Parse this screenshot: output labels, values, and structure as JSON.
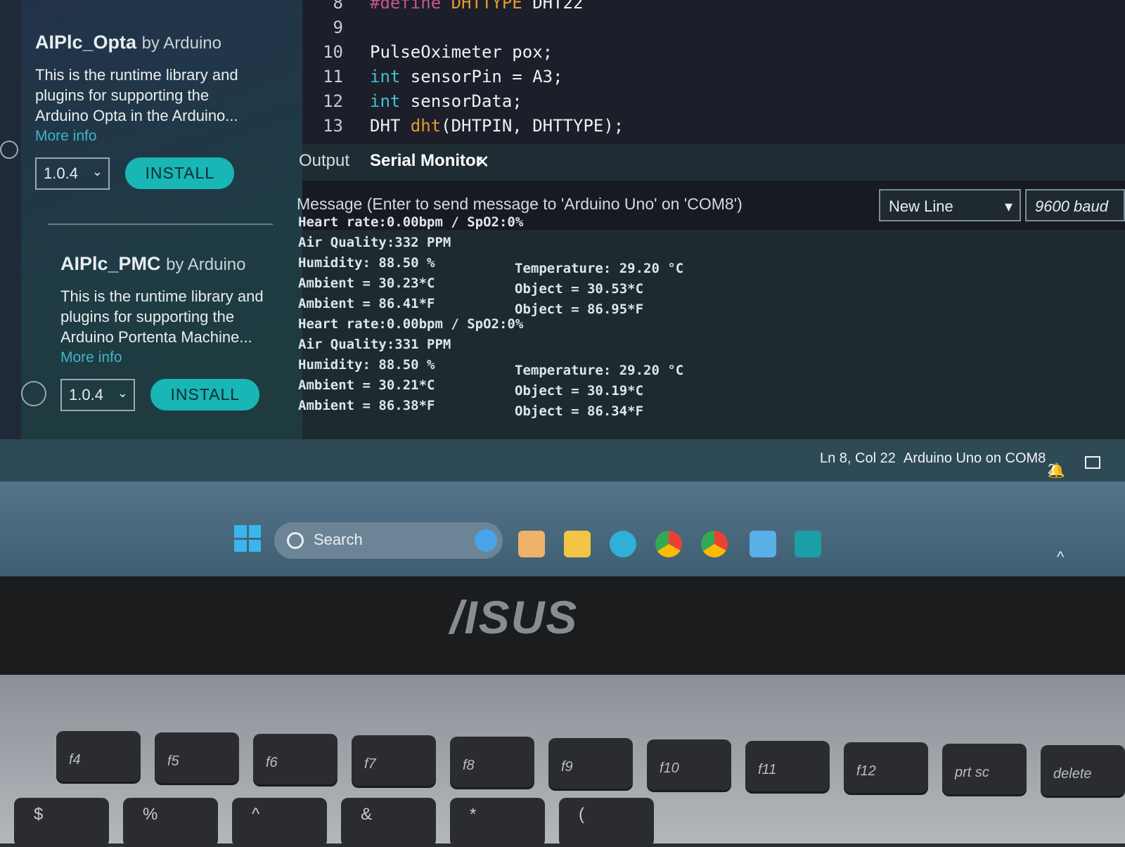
{
  "libraries": [
    {
      "name": "AIPlc_Opta",
      "by": "by Arduino",
      "description": [
        "This is the runtime library and",
        "plugins for supporting the",
        "Arduino Opta in the Arduino..."
      ],
      "more": "More info",
      "version": "1.0.4",
      "install_label": "INSTALL"
    },
    {
      "name": "AIPlc_PMC",
      "by": "by Arduino",
      "description": [
        "This is the runtime library and",
        "plugins for supporting the",
        "Arduino Portenta Machine..."
      ],
      "more": "More info",
      "version": "1.0.4",
      "install_label": "INSTALL"
    }
  ],
  "editor": {
    "lines": [
      {
        "n": "8",
        "parts": [
          [
            "def",
            "#define "
          ],
          [
            "fn",
            "DHTTYPE"
          ],
          [
            "",
            " DHT22"
          ]
        ]
      },
      {
        "n": "9",
        "parts": [
          [
            "",
            ""
          ]
        ]
      },
      {
        "n": "10",
        "parts": [
          [
            "",
            "PulseOximeter pox;"
          ]
        ]
      },
      {
        "n": "11",
        "parts": [
          [
            "kw",
            "int"
          ],
          [
            "",
            " sensorPin = A3;"
          ]
        ]
      },
      {
        "n": "12",
        "parts": [
          [
            "kw",
            "int"
          ],
          [
            "",
            " sensorData;"
          ]
        ]
      },
      {
        "n": "13",
        "parts": [
          [
            "",
            "DHT "
          ],
          [
            "fn",
            "dht"
          ],
          [
            "",
            "(DHTPIN, DHTTYPE);"
          ]
        ]
      }
    ]
  },
  "panel": {
    "tab_output": "Output",
    "tab_serial": "Serial Monitor",
    "close_glyph": "✕",
    "message_placeholder": "Message (Enter to send message to 'Arduino Uno' on 'COM8')",
    "line_ending": "New Line",
    "baud": "9600 baud",
    "collapse_glyph": "»"
  },
  "serial_lines": [
    [
      "Heart rate:0.00bpm / SpO2:0%",
      ""
    ],
    [
      "Air Quality:332 PPM",
      ""
    ],
    [
      "Humidity: 88.50 %",
      "Temperature: 29.20 °C"
    ],
    [
      "Ambient = 30.23*C",
      "Object = 30.53*C"
    ],
    [
      "Ambient = 86.41*F",
      "Object = 86.95*F"
    ],
    [
      "Heart rate:0.00bpm / SpO2:0%",
      ""
    ],
    [
      "Air Quality:331 PPM",
      ""
    ],
    [
      "Humidity: 88.50 %",
      "Temperature: 29.20 °C"
    ],
    [
      "Ambient = 30.21*C",
      "Object = 30.19*C"
    ],
    [
      "Ambient = 86.38*F",
      "Object = 86.34*F"
    ]
  ],
  "status": {
    "position": "Ln 8, Col 22",
    "board": "Arduino Uno on COM8",
    "notifications": "2"
  },
  "taskbar": {
    "search_label": "Search"
  },
  "brand": "/ISUS",
  "keys": [
    "f4",
    "f5",
    "f6",
    "f7",
    "f8",
    "f9",
    "f10",
    "f11",
    "f12",
    "prt sc",
    "delete"
  ],
  "keys_row2": [
    "$",
    "%",
    "^",
    "&",
    "*",
    "("
  ]
}
